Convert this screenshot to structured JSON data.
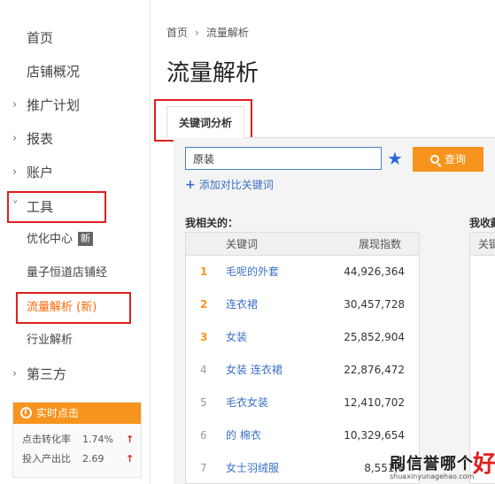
{
  "sidebar": {
    "home": "首页",
    "shop_overview": "店铺概况",
    "groups": [
      {
        "label": "推广计划",
        "chev": "›"
      },
      {
        "label": "报表",
        "chev": "›"
      },
      {
        "label": "账户",
        "chev": "›"
      },
      {
        "label": "工具",
        "chev": "˅"
      }
    ],
    "tools_sub": [
      {
        "label": "优化中心",
        "badge": "新"
      },
      {
        "label": "量子恒道店铺经"
      },
      {
        "label": "流量解析 (新)"
      },
      {
        "label": "行业解析"
      }
    ],
    "third_party": {
      "label": "第三方",
      "chev": "›"
    },
    "realtime": {
      "title": "实时点击",
      "rows": [
        {
          "label": "点击转化率",
          "value": "1.74%",
          "arrow": "↑"
        },
        {
          "label": "投入产出比",
          "value": "2.69",
          "arrow": "↑"
        }
      ]
    }
  },
  "breadcrumb": {
    "home": "首页",
    "sep": "›",
    "current": "流量解析"
  },
  "page_title": "流量解析",
  "tab": {
    "label": "关键词分析"
  },
  "search": {
    "value": "原装",
    "star": "★",
    "button": "查询",
    "add_compare": "添加对比关键词",
    "add_icon": "+"
  },
  "related": {
    "label": "我相关的：",
    "headers": {
      "keyword": "关键词",
      "index": "展现指数"
    },
    "rows": [
      {
        "rank": "1",
        "keyword": "毛呢的外套",
        "index": "44,926,364"
      },
      {
        "rank": "2",
        "keyword": "连衣裙",
        "index": "30,457,728"
      },
      {
        "rank": "3",
        "keyword": "女装",
        "index": "25,852,904"
      },
      {
        "rank": "4",
        "keyword": "女装 连衣裙",
        "index": "22,876,472"
      },
      {
        "rank": "5",
        "keyword": "毛衣女装",
        "index": "12,410,702"
      },
      {
        "rank": "6",
        "keyword": "的 棉衣",
        "index": "10,329,654"
      },
      {
        "rank": "7",
        "keyword": "女士羽绒服",
        "index": "8,551,8"
      }
    ]
  },
  "favorites": {
    "label": "我收藏",
    "header": "关键"
  },
  "watermark": {
    "text": "刷信誉哪个",
    "big": "好",
    "url": "shuaxinyunagehao.com"
  },
  "colors": {
    "accent": "#f7941d",
    "link": "#3a6fc4",
    "highlight_box": "#e02020"
  }
}
